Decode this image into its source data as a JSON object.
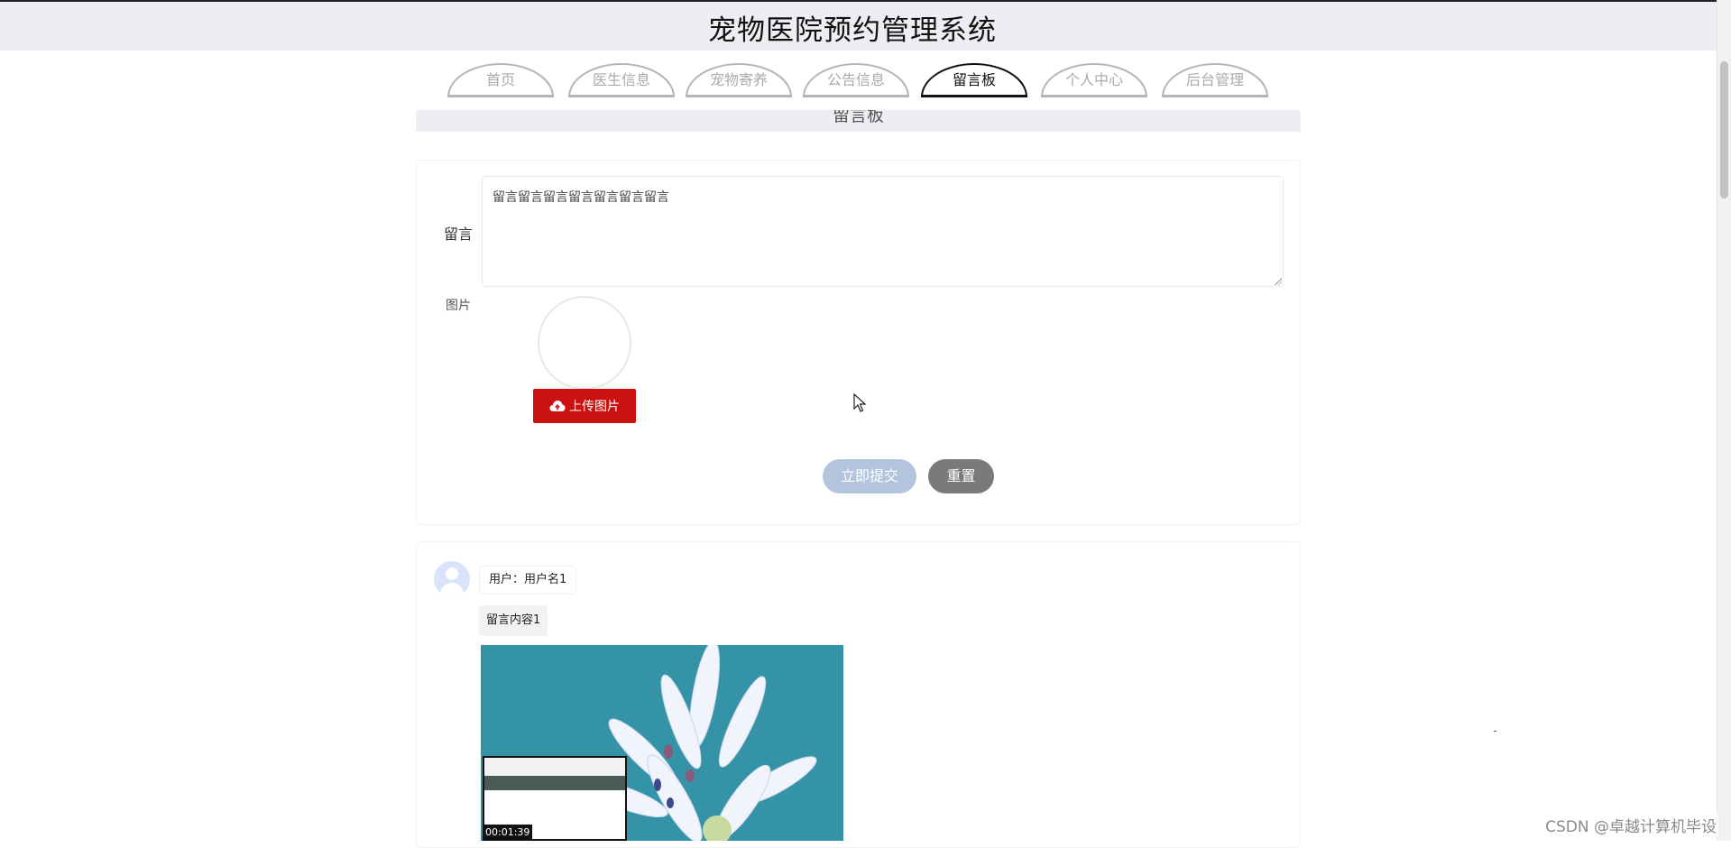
{
  "header": {
    "title": "宠物医院预约管理系统"
  },
  "nav": {
    "items": [
      {
        "label": "首页"
      },
      {
        "label": "医生信息"
      },
      {
        "label": "宠物寄养"
      },
      {
        "label": "公告信息"
      },
      {
        "label": "留言板",
        "active": true
      },
      {
        "label": "个人中心"
      },
      {
        "label": "后台管理"
      }
    ]
  },
  "section": {
    "title": "留言板"
  },
  "form": {
    "message_label": "留言",
    "message_value": "留言留言留言留言留言留言留言",
    "image_label": "图片",
    "upload_label": "上传图片",
    "submit_label": "立即提交",
    "reset_label": "重置"
  },
  "messages": [
    {
      "user": "用户：用户名1",
      "content": "留言内容1",
      "video_time": "00:01:39"
    }
  ],
  "watermark": "CSDN @卓越计算机毕设",
  "colors": {
    "accent_red": "#cc1111",
    "submit_blue": "#b3c4dd",
    "reset_gray": "#7a7a7a",
    "header_bg": "#eeeef2"
  }
}
